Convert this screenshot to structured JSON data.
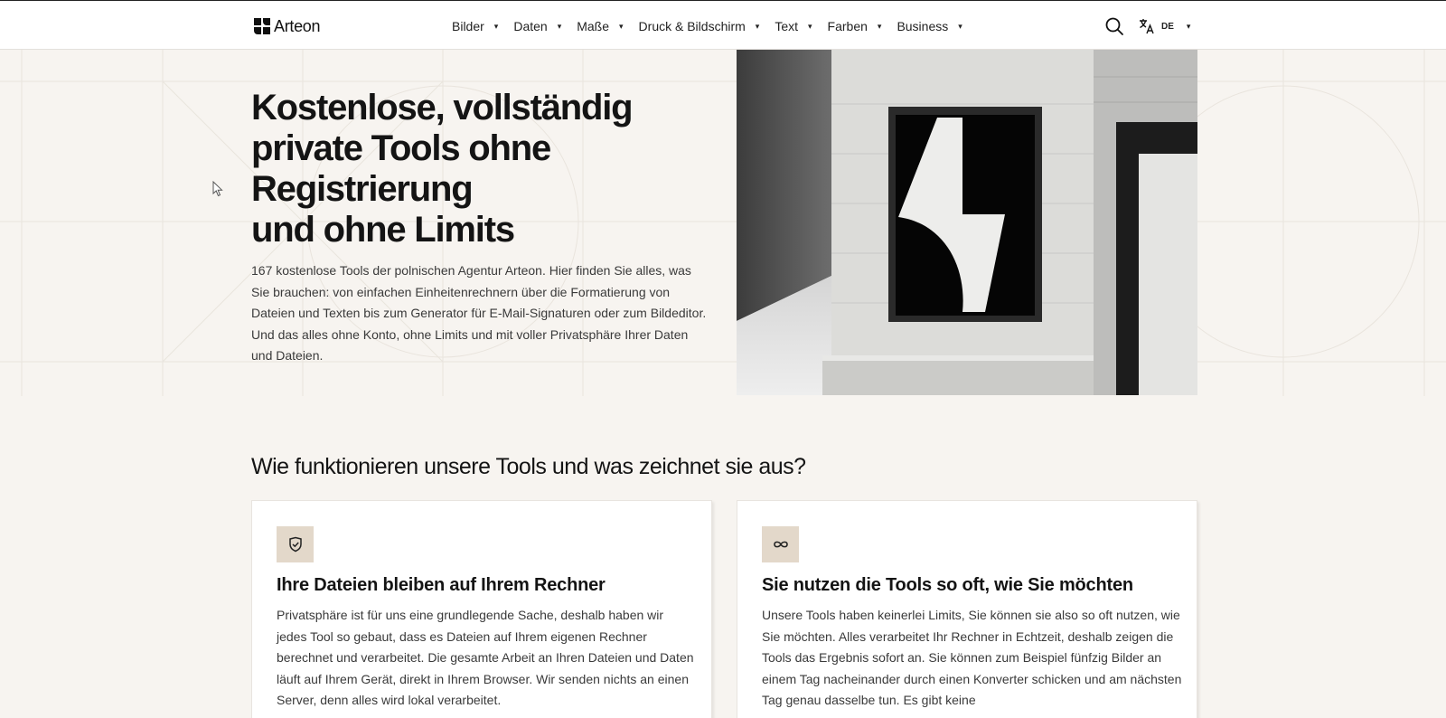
{
  "header": {
    "logo_text": "Arteon",
    "nav": [
      {
        "label": "Bilder"
      },
      {
        "label": "Daten"
      },
      {
        "label": "Maße"
      },
      {
        "label": "Druck & Bildschirm"
      },
      {
        "label": "Text"
      },
      {
        "label": "Farben"
      },
      {
        "label": "Business"
      }
    ],
    "search_icon": "search-icon",
    "language_icon": "translate-icon",
    "language_code": "DE",
    "caret": "▾"
  },
  "hero": {
    "title_lines": [
      "Kostenlose, vollständig",
      "private Tools ohne",
      "Registrierung",
      "und ohne Limits"
    ],
    "description": "167 kostenlose Tools der polnischen Agentur Arteon. Hier finden Sie alles, was Sie brauchen: von einfachen Einheitenrechnern über die Formatierung von Dateien und Texten bis zum Generator für E-Mail-Signaturen oder zum Bildeditor. Und das alles ohne Konto, ohne Limits und mit voller Privatsphäre Ihrer Daten und Dateien."
  },
  "features": {
    "title": "Wie funktionieren unsere Tools und was zeichnet sie aus?",
    "cards": [
      {
        "icon": "shield-check-icon",
        "title": "Ihre Dateien bleiben auf Ihrem Rechner",
        "text": "Privatsphäre ist für uns eine grundlegende Sache, deshalb haben wir jedes Tool so gebaut, dass es Dateien auf Ihrem eigenen Rechner berechnet und verarbeitet. Die gesamte Arbeit an Ihren Dateien und Daten läuft auf Ihrem Gerät, direkt in Ihrem Browser. Wir senden nichts an einen Server, denn alles wird lokal verarbeitet."
      },
      {
        "icon": "infinity-icon",
        "title": "Sie nutzen die Tools so oft, wie Sie möchten",
        "text": "Unsere Tools haben keinerlei Limits, Sie können sie also so oft nutzen, wie Sie möchten. Alles verarbeitet Ihr Rechner in Echtzeit, deshalb zeigen die Tools das Ergebnis sofort an. Sie können zum Beispiel fünfzig Bilder an einem Tag nacheinander durch einen Konverter schicken und am nächsten Tag genau dasselbe tun. Es gibt keine"
      }
    ]
  },
  "colors": {
    "background": "#f7f4f0",
    "icon_badge": "#e3d8ca",
    "text": "#141414"
  }
}
